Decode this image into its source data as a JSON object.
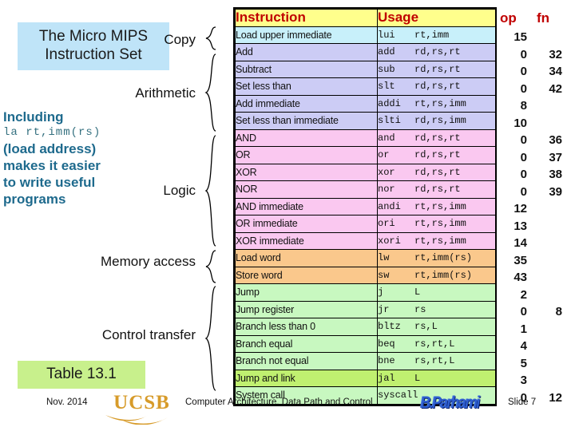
{
  "title": {
    "line1": "The Micro MIPS",
    "line2": "Instruction Set"
  },
  "note": {
    "heading": "Including",
    "code": "la   rt,imm(rs)",
    "body_line1": "(load address)",
    "body_line2": "makes it easier",
    "body_line3": "to write useful",
    "body_line4": "programs"
  },
  "table_label": "Table 13.1",
  "group_labels": {
    "copy": "Copy",
    "arithmetic": "Arithmetic",
    "logic": "Logic",
    "memory": "Memory access",
    "control": "Control transfer"
  },
  "table": {
    "headers": {
      "instruction": "Instruction",
      "usage": "Usage",
      "op": "op",
      "fn": "fn"
    },
    "rows": [
      {
        "instruction": "Load upper immediate",
        "mnemonic": "lui",
        "operands": "rt,imm",
        "op": "15",
        "fn": "",
        "group": "copy"
      },
      {
        "instruction": "Add",
        "mnemonic": "add",
        "operands": "rd,rs,rt",
        "op": "0",
        "fn": "32",
        "group": "arithmetic"
      },
      {
        "instruction": "Subtract",
        "mnemonic": "sub",
        "operands": "rd,rs,rt",
        "op": "0",
        "fn": "34",
        "group": "arithmetic"
      },
      {
        "instruction": "Set less than",
        "mnemonic": "slt",
        "operands": "rd,rs,rt",
        "op": "0",
        "fn": "42",
        "group": "arithmetic"
      },
      {
        "instruction": "Add immediate",
        "mnemonic": "addi",
        "operands": "rt,rs,imm",
        "op": "8",
        "fn": "",
        "group": "arithmetic"
      },
      {
        "instruction": "Set less than immediate",
        "mnemonic": "slti",
        "operands": "rd,rs,imm",
        "op": "10",
        "fn": "",
        "group": "arithmetic"
      },
      {
        "instruction": "AND",
        "mnemonic": "and",
        "operands": "rd,rs,rt",
        "op": "0",
        "fn": "36",
        "group": "logic"
      },
      {
        "instruction": "OR",
        "mnemonic": "or",
        "operands": "rd,rs,rt",
        "op": "0",
        "fn": "37",
        "group": "logic"
      },
      {
        "instruction": "XOR",
        "mnemonic": "xor",
        "operands": "rd,rs,rt",
        "op": "0",
        "fn": "38",
        "group": "logic"
      },
      {
        "instruction": "NOR",
        "mnemonic": "nor",
        "operands": "rd,rs,rt",
        "op": "0",
        "fn": "39",
        "group": "logic"
      },
      {
        "instruction": "AND immediate",
        "mnemonic": "andi",
        "operands": "rt,rs,imm",
        "op": "12",
        "fn": "",
        "group": "logic"
      },
      {
        "instruction": "OR immediate",
        "mnemonic": "ori",
        "operands": "rt,rs,imm",
        "op": "13",
        "fn": "",
        "group": "logic"
      },
      {
        "instruction": "XOR immediate",
        "mnemonic": "xori",
        "operands": "rt,rs,imm",
        "op": "14",
        "fn": "",
        "group": "logic"
      },
      {
        "instruction": "Load word",
        "mnemonic": "lw",
        "operands": "rt,imm(rs)",
        "op": "35",
        "fn": "",
        "group": "memory"
      },
      {
        "instruction": "Store word",
        "mnemonic": "sw",
        "operands": "rt,imm(rs)",
        "op": "43",
        "fn": "",
        "group": "memory"
      },
      {
        "instruction": "Jump",
        "mnemonic": "j",
        "operands": "L",
        "op": "2",
        "fn": "",
        "group": "control"
      },
      {
        "instruction": "Jump register",
        "mnemonic": "jr",
        "operands": "rs",
        "op": "0",
        "fn": "8",
        "group": "control"
      },
      {
        "instruction": "Branch less than 0",
        "mnemonic": "bltz",
        "operands": "rs,L",
        "op": "1",
        "fn": "",
        "group": "control"
      },
      {
        "instruction": "Branch equal",
        "mnemonic": "beq",
        "operands": "rs,rt,L",
        "op": "4",
        "fn": "",
        "group": "control"
      },
      {
        "instruction": "Branch not equal",
        "mnemonic": "bne",
        "operands": "rs,rt,L",
        "op": "5",
        "fn": "",
        "group": "control"
      },
      {
        "instruction": "Jump and link",
        "mnemonic": "jal",
        "operands": "L",
        "op": "3",
        "fn": "",
        "group": "control2"
      },
      {
        "instruction": "System call",
        "mnemonic": "syscall",
        "operands": "",
        "op": "0",
        "fn": "12",
        "group": "control"
      }
    ]
  },
  "footer": {
    "date": "Nov. 2014",
    "logo": "UCSB",
    "center": "Computer Architecture, Data Path and Control",
    "author_logo": "B.Parhami",
    "slide": "Slide 7"
  },
  "colors": {
    "header_bg": "#ffff8c",
    "header_text": "#c00000",
    "copy_row": "#c8f0fa",
    "arith_row": "#ccccf5",
    "logic_row": "#fac8f0",
    "memory_row": "#fac88c",
    "control_row": "#c8f8c0",
    "title_bg": "#bfe4f8",
    "table_label_bg": "#c8f08c",
    "note_text": "#1e6a8d"
  }
}
